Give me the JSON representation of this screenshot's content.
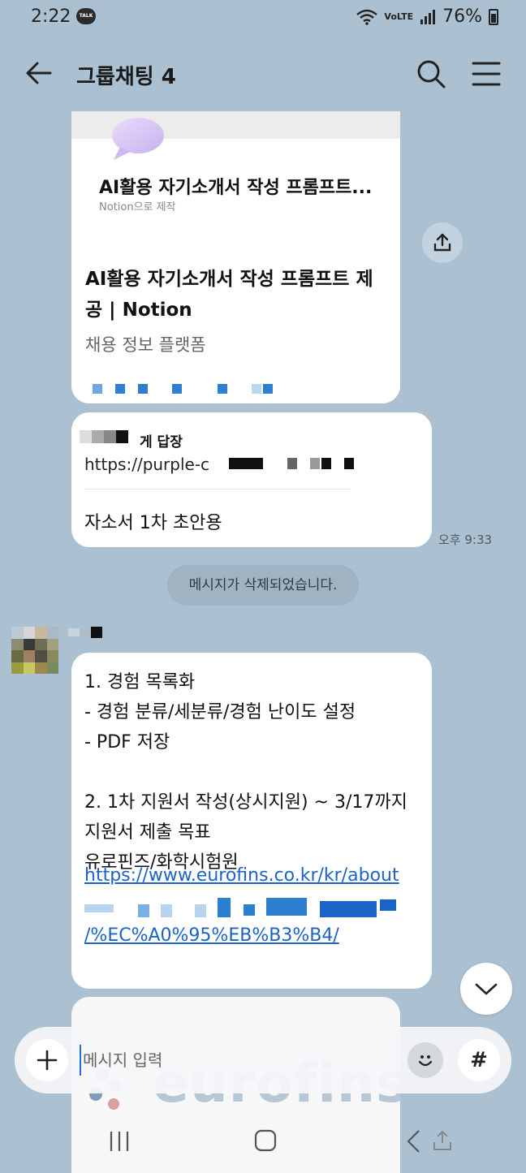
{
  "status_bar": {
    "time": "2:22",
    "talk_badge": "TALK",
    "network": "VoLTE",
    "battery": "76%"
  },
  "header": {
    "title": "그룹채팅 4",
    "icons": [
      "back-arrow-icon",
      "search-icon",
      "menu-icon"
    ]
  },
  "link_card": {
    "notion_title": "AI활용 자기소개서 작성 프롬프트...",
    "notion_made_by": "Notion으로 제작",
    "title": "AI활용 자기소개서 작성 프롬프트 제공 | Notion",
    "description": "채용 정보 플랫폼"
  },
  "reply_message": {
    "reply_to": "게 답장",
    "quoted_url": "https://purple-c",
    "text": "자소서 1차 초안용",
    "time": "오후 9:33"
  },
  "system_message": "메시지가 삭제되었습니다.",
  "text_message": {
    "lines": "1. 경험 목록화\n- 경험 분류/세분류/경험 난이도 설정\n- PDF 저장\n\n2. 1차 지원서 작성(상시지원) ~ 3/17까지\n지원서 제출 목표\n유로핀즈/화학시험원",
    "link_first": "https://www.eurofins.co.kr/kr/about",
    "link_last": "/%EC%A0%95%EB%B3%B4/"
  },
  "next_card": {
    "watermark": "eurofins"
  },
  "input_bar": {
    "placeholder": "메시지 입력",
    "hash_label": "#"
  },
  "colors": {
    "background": "#abc1d1",
    "bubble": "#ffffff",
    "link": "#1b63c7",
    "system_pill": "#9fb3c3"
  }
}
